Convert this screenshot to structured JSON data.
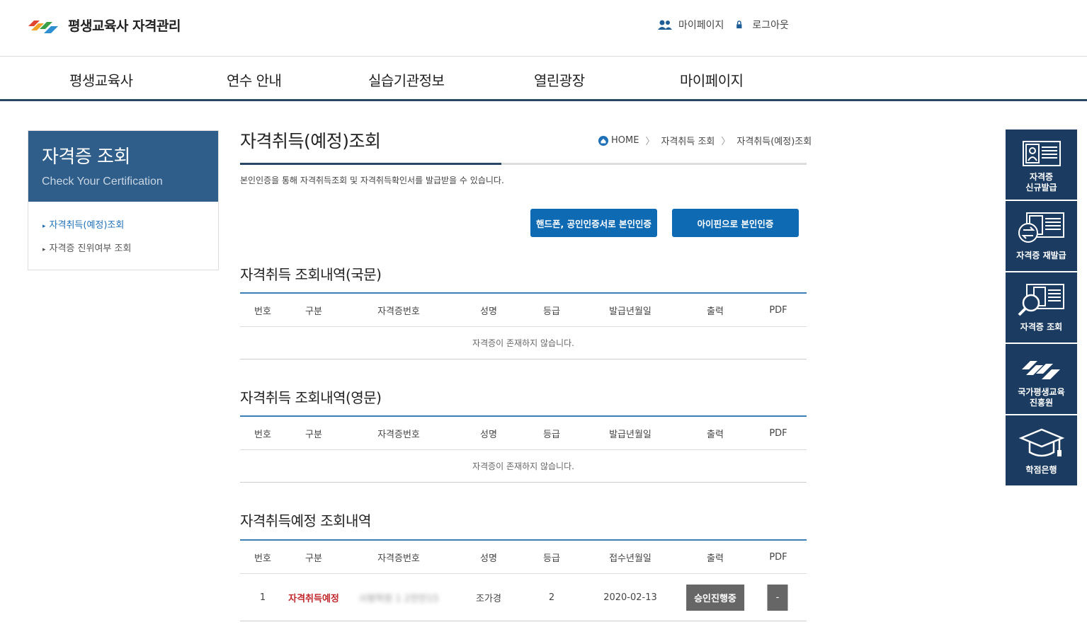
{
  "header": {
    "logo_text": "평생교육사 자격관리",
    "mypage": "마이페이지",
    "logout": "로그아웃"
  },
  "gnb": [
    "평생교육사",
    "연수 안내",
    "실습기관정보",
    "열린광장",
    "마이페이지"
  ],
  "lnb": {
    "title": "자격증 조회",
    "subtitle": "Check Your Certification",
    "items": [
      "자격취득(예정)조회",
      "자격증 진위여부 조회"
    ]
  },
  "page": {
    "title": "자격취득(예정)조회",
    "breadcrumb": [
      "HOME",
      "자격취득 조회",
      "자격취득(예정)조회"
    ],
    "description": "본인인증을 통해 자격취득조회 및 자격취득확인서를 발급받을 수 있습니다."
  },
  "buttons": {
    "phone_auth": "핸드폰, 공인인증서로 본인인증",
    "ipin_auth": "아이핀으로 본인인증"
  },
  "sections": [
    {
      "title": "자격취득 조회내역(국문)",
      "headers": [
        "번호",
        "구분",
        "자격증번호",
        "성명",
        "등급",
        "발급년월일",
        "출력",
        "PDF"
      ],
      "empty": "자격증이 존재하지 않습니다."
    },
    {
      "title": "자격취득 조회내역(영문)",
      "headers": [
        "번호",
        "구분",
        "자격증번호",
        "성명",
        "등급",
        "발급년월일",
        "출력",
        "PDF"
      ],
      "empty": "자격증이 존재하지 않습니다."
    },
    {
      "title": "자격취득예정 조회내역",
      "headers": [
        "번호",
        "구분",
        "자격증번호",
        "성명",
        "등급",
        "접수년월일",
        "출력",
        "PDF"
      ],
      "rows": [
        {
          "no": "1",
          "type": "자격취득예정",
          "cert_no": "사평학원 1 2천만15",
          "name": "조가경",
          "grade": "2",
          "date": "2020-02-13",
          "status": "승인진행중",
          "pdf": "-"
        }
      ]
    }
  ],
  "quick_menu": [
    {
      "label": "자격증 신규발급",
      "icon": "id-card-icon"
    },
    {
      "label": "자격증 재발급",
      "icon": "id-card-reissue-icon"
    },
    {
      "label": "자격증 조회",
      "icon": "id-card-search-icon"
    },
    {
      "label": "국가평생교육 진흥원",
      "icon": "institute-logo-icon"
    },
    {
      "label": "학점은행",
      "icon": "graduation-cap-icon"
    }
  ],
  "colors": {
    "navy": "#1b3b60",
    "accent": "#0f6ab4",
    "lnb_head": "#2f5e8a",
    "status_red": "#c0272d"
  }
}
